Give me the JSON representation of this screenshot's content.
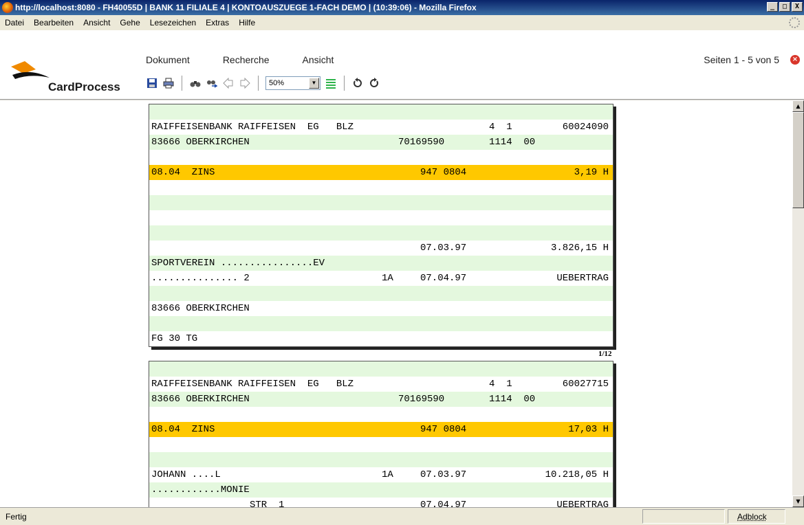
{
  "window": {
    "title": "http://localhost:8080 - FH40055D | BANK 11 FILIALE 4 | KONTOAUSZUEGE 1-FACH DEMO | (10:39:06) - Mozilla Firefox",
    "buttons": [
      "_",
      "□",
      "X"
    ]
  },
  "menu": [
    "Datei",
    "Bearbeiten",
    "Ansicht",
    "Gehe",
    "Lesezeichen",
    "Extras",
    "Hilfe"
  ],
  "app": {
    "brand": "CardProcess",
    "menu": [
      "Dokument",
      "Recherche",
      "Ansicht"
    ],
    "pages": "Seiten 1 - 5 von 5",
    "zoom": "50%",
    "toolbar_icons": [
      "save-icon",
      "print-icon",
      "find-icon",
      "find-next-icon",
      "prev-page-icon",
      "next-page-icon",
      "zoom-select",
      "fit-icon",
      "rotate-left-icon",
      "rotate-right-icon"
    ]
  },
  "documents": [
    {
      "page_label": "1/12",
      "rows": [
        {
          "bg": "g",
          "cells": []
        },
        {
          "bg": "w",
          "cells": [
            "RAIFFEISENBANK RAIFFEISEN  EG   BLZ",
            "4  1",
            "60024090"
          ]
        },
        {
          "bg": "g",
          "cells": [
            "83666 OBERKIRCHEN",
            "70169590",
            "1114  00"
          ]
        },
        {
          "bg": "w",
          "cells": []
        },
        {
          "bg": "y",
          "cells": [
            "08.04  ZINS",
            "947 0804",
            "3,19 H"
          ]
        },
        {
          "bg": "w",
          "cells": []
        },
        {
          "bg": "g",
          "cells": []
        },
        {
          "bg": "w",
          "cells": []
        },
        {
          "bg": "g",
          "cells": []
        },
        {
          "bg": "w",
          "cells": [
            "",
            "07.03.97",
            "3.826,15 H"
          ]
        },
        {
          "bg": "g",
          "cells": [
            "SPORTVEREIN ................EV"
          ]
        },
        {
          "bg": "w",
          "cells": [
            "............... 2",
            "1A",
            "07.04.97",
            "UEBERTRAG"
          ]
        },
        {
          "bg": "g",
          "cells": []
        },
        {
          "bg": "w",
          "cells": [
            "83666 OBERKIRCHEN"
          ]
        },
        {
          "bg": "g",
          "cells": []
        },
        {
          "bg": "w",
          "cells": [
            "FG 30 TG"
          ]
        }
      ]
    },
    {
      "page_label": "",
      "rows": [
        {
          "bg": "g",
          "cells": []
        },
        {
          "bg": "w",
          "cells": [
            "RAIFFEISENBANK RAIFFEISEN  EG   BLZ",
            "4  1",
            "60027715"
          ]
        },
        {
          "bg": "g",
          "cells": [
            "83666 OBERKIRCHEN",
            "70169590",
            "1114  00"
          ]
        },
        {
          "bg": "w",
          "cells": []
        },
        {
          "bg": "y",
          "cells": [
            "08.04  ZINS",
            "947 0804",
            "17,03 H"
          ]
        },
        {
          "bg": "w",
          "cells": []
        },
        {
          "bg": "g",
          "cells": []
        },
        {
          "bg": "w",
          "cells": [
            "JOHANN ....L",
            "1A",
            "07.03.97",
            "10.218,05 H"
          ]
        },
        {
          "bg": "g",
          "cells": [
            "............MONIE"
          ]
        },
        {
          "bg": "w",
          "cells": [
            "STR  1",
            "07.04.97",
            "UEBERTRAG"
          ]
        }
      ]
    }
  ],
  "status": {
    "text": "Fertig",
    "adblock": "Adblock"
  }
}
